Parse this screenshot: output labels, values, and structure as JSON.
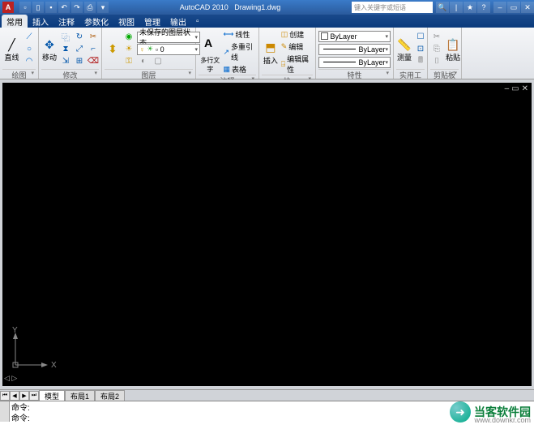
{
  "title": {
    "app": "AutoCAD 2010",
    "doc": "Drawing1.dwg",
    "search_placeholder": "键入关键字或短语"
  },
  "tabs": {
    "t0": "常用",
    "t1": "插入",
    "t2": "注释",
    "t3": "参数化",
    "t4": "视图",
    "t5": "管理",
    "t6": "输出"
  },
  "ribbon": {
    "draw": {
      "title": "绘图",
      "main": "直线"
    },
    "modify": {
      "title": "修改",
      "main": "移动"
    },
    "layers": {
      "title": "图层",
      "unsaved": "未保存的图层状态",
      "zero": "0"
    },
    "annot": {
      "title": "注释",
      "mtext": "多行文字",
      "table": "表格",
      "linear": "线性",
      "mleader": "多重引线"
    },
    "block": {
      "title": "块",
      "insert": "插入",
      "create": "创建",
      "edit": "编辑",
      "attr": "编辑属性"
    },
    "props": {
      "title": "特性",
      "bylayer": "ByLayer"
    },
    "utils": {
      "title": "实用工具",
      "measure": "测量"
    },
    "clip": {
      "title": "剪贴板",
      "paste": "粘贴"
    }
  },
  "layout": {
    "model": "模型",
    "l1": "布局1",
    "l2": "布局2"
  },
  "cmd": {
    "c1": "命令:",
    "c2": "命令:"
  },
  "axes": {
    "x": "X",
    "y": "Y"
  },
  "watermark": {
    "text": "当客软件园",
    "url": "www.downkr.com"
  }
}
